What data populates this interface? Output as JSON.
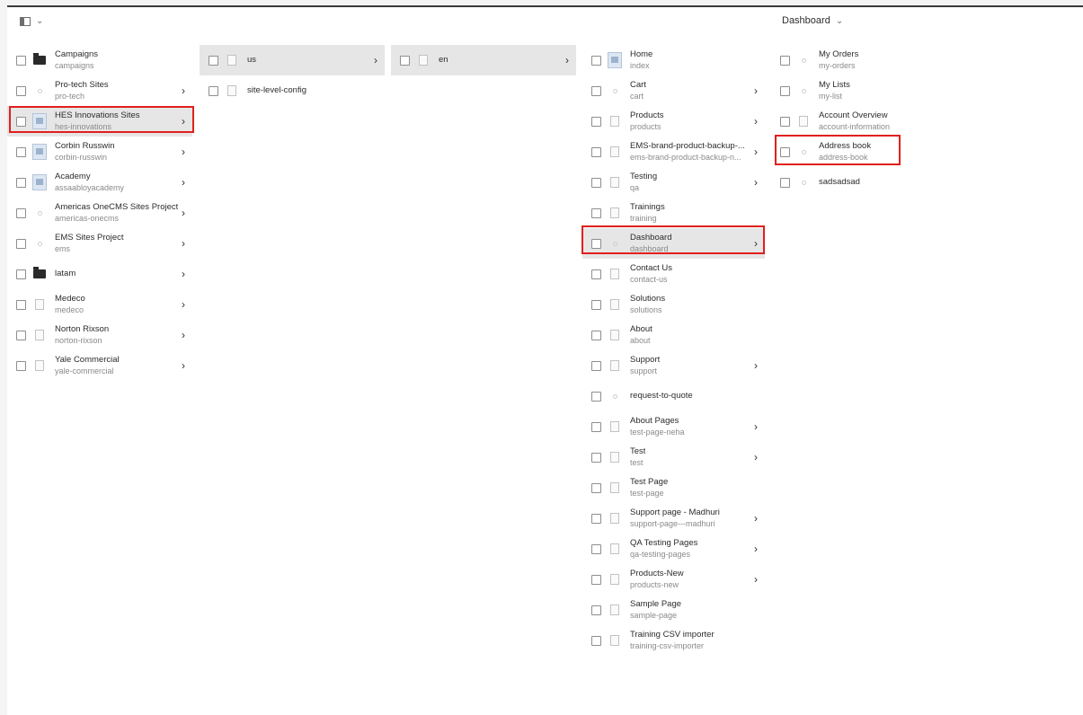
{
  "header": {
    "rail_chevron": "⌄",
    "view_label": "Dashboard",
    "view_chevron": "⌄"
  },
  "icons": {
    "folder": "folder-icon",
    "doc": "page-thumbnail-icon",
    "page": "page-icon",
    "dot": "placeholder-icon",
    "arrow": "chevron-right-icon"
  },
  "colors": {
    "highlight": "#e0201d",
    "selected_bg": "#e6e6e6"
  },
  "columns": [
    {
      "items": [
        {
          "title": "Campaigns",
          "sub": "campaigns"
        },
        {
          "title": "Pro-tech Sites",
          "sub": "pro-tech"
        },
        {
          "title": "HES Innovations Sites",
          "sub": "hes-innovations"
        },
        {
          "title": "Corbin Russwin",
          "sub": "corbin-russwin"
        },
        {
          "title": "Academy",
          "sub": "assaabloyacademy"
        },
        {
          "title": "Americas OneCMS Sites Project",
          "sub": "americas-onecms"
        },
        {
          "title": "EMS Sites Project",
          "sub": "ems"
        },
        {
          "title": "latam",
          "sub": ""
        },
        {
          "title": "Medeco",
          "sub": "medeco"
        },
        {
          "title": "Norton Rixson",
          "sub": "norton-rixson"
        },
        {
          "title": "Yale Commercial",
          "sub": "yale-commercial"
        }
      ]
    },
    {
      "items": [
        {
          "title": "us",
          "sub": ""
        },
        {
          "title": "site-level-config",
          "sub": ""
        }
      ]
    },
    {
      "items": [
        {
          "title": "en",
          "sub": ""
        }
      ]
    },
    {
      "items": [
        {
          "title": "Home",
          "sub": "index"
        },
        {
          "title": "Cart",
          "sub": "cart"
        },
        {
          "title": "Products",
          "sub": "products"
        },
        {
          "title": "EMS-brand-product-backup-...",
          "sub": "ems-brand-product-backup-n..."
        },
        {
          "title": "Testing",
          "sub": "qa"
        },
        {
          "title": "Trainings",
          "sub": "training"
        },
        {
          "title": "Dashboard",
          "sub": "dashboard"
        },
        {
          "title": "Contact Us",
          "sub": "contact-us"
        },
        {
          "title": "Solutions",
          "sub": "solutions"
        },
        {
          "title": "About",
          "sub": "about"
        },
        {
          "title": "Support",
          "sub": "support"
        },
        {
          "title": "request-to-quote",
          "sub": ""
        },
        {
          "title": "About Pages",
          "sub": "test-page-neha"
        },
        {
          "title": "Test",
          "sub": "test"
        },
        {
          "title": "Test Page",
          "sub": "test-page"
        },
        {
          "title": "Support page - Madhuri",
          "sub": "support-page---madhuri"
        },
        {
          "title": "QA Testing Pages",
          "sub": "qa-testing-pages"
        },
        {
          "title": "Products-New",
          "sub": "products-new"
        },
        {
          "title": "Sample Page",
          "sub": "sample-page"
        },
        {
          "title": "Training CSV importer",
          "sub": "training-csv-importer"
        }
      ]
    },
    {
      "items": [
        {
          "title": "My Orders",
          "sub": "my-orders"
        },
        {
          "title": "My Lists",
          "sub": "my-list"
        },
        {
          "title": "Account Overview",
          "sub": "account-information"
        },
        {
          "title": "Address book",
          "sub": "address-book"
        },
        {
          "title": "sadsadsad",
          "sub": ""
        }
      ]
    }
  ]
}
